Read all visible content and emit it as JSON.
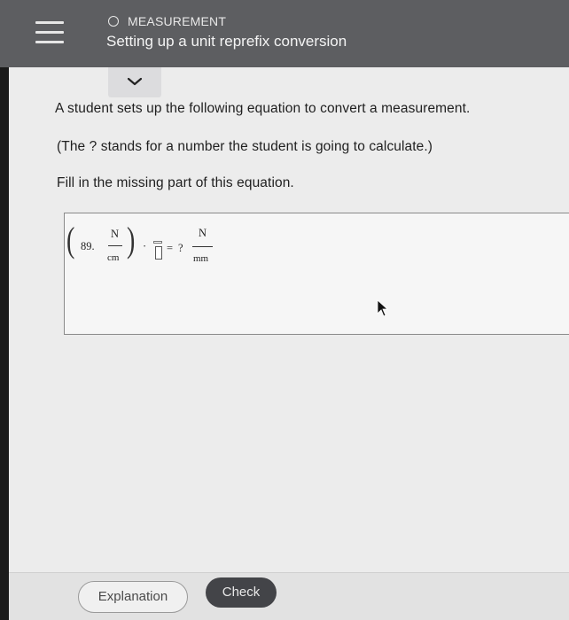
{
  "header": {
    "topic": "MEASUREMENT",
    "lesson_title": "Setting up a unit reprefix conversion"
  },
  "question": {
    "line1": "A student sets up the following equation to convert a measurement.",
    "line2": "(The ? stands for a number the student is going to calculate.)",
    "line3": "Fill in the missing part of this equation."
  },
  "equation": {
    "coefficient": "89.",
    "left_numerator": "N",
    "left_denominator": "cm",
    "dot": "·",
    "equals": "=",
    "unknown": "?",
    "right_numerator": "N",
    "right_denominator": "mm"
  },
  "footer": {
    "explanation_label": "Explanation",
    "check_label": "Check"
  },
  "colors": {
    "header_bg": "#5d5e61",
    "content_bg": "#ececec",
    "check_bg": "#434448"
  }
}
